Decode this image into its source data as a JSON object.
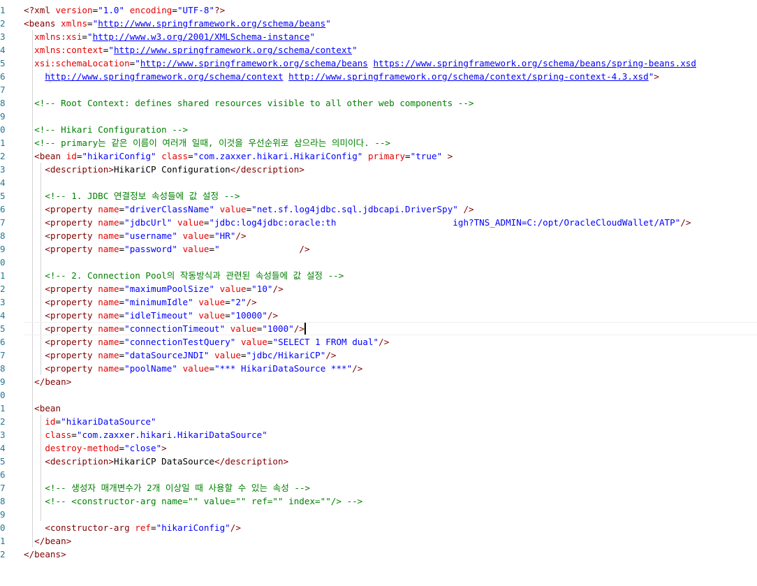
{
  "editor": {
    "line_numbers": [
      "1",
      "2",
      "3",
      "4",
      "5",
      "6",
      "7",
      "8",
      "9",
      "0",
      "1",
      "2",
      "3",
      "4",
      "5",
      "6",
      "7",
      "8",
      "9",
      "0",
      "1",
      "2",
      "3",
      "4",
      "5",
      "6",
      "7",
      "8",
      "9",
      "0",
      "1",
      "2",
      "3",
      "4",
      "5",
      "6",
      "7",
      "8",
      "9",
      "0",
      "1",
      "2"
    ],
    "lines": [
      [
        {
          "c": "t-punct",
          "t": "<?"
        },
        {
          "c": "t-tag",
          "t": "xml"
        },
        {
          "c": "t-txt",
          "t": " "
        },
        {
          "c": "t-attr",
          "t": "version"
        },
        {
          "c": "t-txt",
          "t": "="
        },
        {
          "c": "t-val",
          "t": "\"1.0\""
        },
        {
          "c": "t-txt",
          "t": " "
        },
        {
          "c": "t-attr",
          "t": "encoding"
        },
        {
          "c": "t-txt",
          "t": "="
        },
        {
          "c": "t-val",
          "t": "\"UTF-8\""
        },
        {
          "c": "t-punct",
          "t": "?>"
        }
      ],
      [
        {
          "c": "t-punct",
          "t": "<"
        },
        {
          "c": "t-tag",
          "t": "beans"
        },
        {
          "c": "t-txt",
          "t": " "
        },
        {
          "c": "t-attr",
          "t": "xmlns"
        },
        {
          "c": "t-txt",
          "t": "="
        },
        {
          "c": "t-val",
          "t": "\""
        },
        {
          "c": "t-link",
          "t": "http://www.springframework.org/schema/beans"
        },
        {
          "c": "t-val",
          "t": "\""
        }
      ],
      [
        {
          "c": "t-txt",
          "t": "  "
        },
        {
          "c": "t-attr",
          "t": "xmlns:xsi"
        },
        {
          "c": "t-txt",
          "t": "="
        },
        {
          "c": "t-val",
          "t": "\""
        },
        {
          "c": "t-link",
          "t": "http://www.w3.org/2001/XMLSchema-instance"
        },
        {
          "c": "t-val",
          "t": "\""
        }
      ],
      [
        {
          "c": "t-txt",
          "t": "  "
        },
        {
          "c": "t-attr",
          "t": "xmlns:context"
        },
        {
          "c": "t-txt",
          "t": "="
        },
        {
          "c": "t-val",
          "t": "\""
        },
        {
          "c": "t-link",
          "t": "http://www.springframework.org/schema/context"
        },
        {
          "c": "t-val",
          "t": "\""
        }
      ],
      [
        {
          "c": "t-txt",
          "t": "  "
        },
        {
          "c": "t-attr",
          "t": "xsi:schemaLocation"
        },
        {
          "c": "t-txt",
          "t": "="
        },
        {
          "c": "t-val",
          "t": "\""
        },
        {
          "c": "t-link",
          "t": "http://www.springframework.org/schema/beans"
        },
        {
          "c": "t-val",
          "t": " "
        },
        {
          "c": "t-link",
          "t": "https://www.springframework.org/schema/beans/spring-beans.xsd"
        }
      ],
      [
        {
          "c": "t-txt",
          "t": "    "
        },
        {
          "c": "t-link",
          "t": "http://www.springframework.org/schema/context"
        },
        {
          "c": "t-val",
          "t": " "
        },
        {
          "c": "t-link",
          "t": "http://www.springframework.org/schema/context/spring-context-4.3.xsd"
        },
        {
          "c": "t-val",
          "t": "\""
        },
        {
          "c": "t-punct",
          "t": ">"
        }
      ],
      [],
      [
        {
          "c": "t-txt",
          "t": "  "
        },
        {
          "c": "t-cmt",
          "t": "<!-- Root Context: defines shared resources visible to all other web components -->"
        }
      ],
      [],
      [
        {
          "c": "t-txt",
          "t": "  "
        },
        {
          "c": "t-cmt",
          "t": "<!-- Hikari Configuration -->"
        }
      ],
      [
        {
          "c": "t-txt",
          "t": "  "
        },
        {
          "c": "t-cmt",
          "t": "<!-- primary는 같은 이름이 여러개 일때, 이것을 우선순위로 삼으라는 의미이다. -->"
        }
      ],
      [
        {
          "c": "t-txt",
          "t": "  "
        },
        {
          "c": "t-punct",
          "t": "<"
        },
        {
          "c": "t-tag",
          "t": "bean"
        },
        {
          "c": "t-txt",
          "t": " "
        },
        {
          "c": "t-attr",
          "t": "id"
        },
        {
          "c": "t-txt",
          "t": "="
        },
        {
          "c": "t-val",
          "t": "\"hikariConfig\""
        },
        {
          "c": "t-txt",
          "t": " "
        },
        {
          "c": "t-attr",
          "t": "class"
        },
        {
          "c": "t-txt",
          "t": "="
        },
        {
          "c": "t-val",
          "t": "\"com.zaxxer.hikari.HikariConfig\""
        },
        {
          "c": "t-txt",
          "t": " "
        },
        {
          "c": "t-attr",
          "t": "primary"
        },
        {
          "c": "t-txt",
          "t": "="
        },
        {
          "c": "t-val",
          "t": "\"true\""
        },
        {
          "c": "t-txt",
          "t": " "
        },
        {
          "c": "t-punct",
          "t": ">"
        }
      ],
      [
        {
          "c": "t-txt",
          "t": "    "
        },
        {
          "c": "t-punct",
          "t": "<"
        },
        {
          "c": "t-tag",
          "t": "description"
        },
        {
          "c": "t-punct",
          "t": ">"
        },
        {
          "c": "t-txt",
          "t": "HikariCP Configuration"
        },
        {
          "c": "t-punct",
          "t": "</"
        },
        {
          "c": "t-tag",
          "t": "description"
        },
        {
          "c": "t-punct",
          "t": ">"
        }
      ],
      [],
      [
        {
          "c": "t-txt",
          "t": "    "
        },
        {
          "c": "t-cmt",
          "t": "<!-- 1. JDBC 연결정보 속성들에 값 설정 -->"
        }
      ],
      [
        {
          "c": "t-txt",
          "t": "    "
        },
        {
          "c": "t-punct",
          "t": "<"
        },
        {
          "c": "t-tag",
          "t": "property"
        },
        {
          "c": "t-txt",
          "t": " "
        },
        {
          "c": "t-attr",
          "t": "name"
        },
        {
          "c": "t-txt",
          "t": "="
        },
        {
          "c": "t-val",
          "t": "\"driverClassName\""
        },
        {
          "c": "t-txt",
          "t": " "
        },
        {
          "c": "t-attr",
          "t": "value"
        },
        {
          "c": "t-txt",
          "t": "="
        },
        {
          "c": "t-val",
          "t": "\"net.sf.log4jdbc.sql.jdbcapi.DriverSpy\""
        },
        {
          "c": "t-txt",
          "t": " "
        },
        {
          "c": "t-punct",
          "t": "/>"
        }
      ],
      [
        {
          "c": "t-txt",
          "t": "    "
        },
        {
          "c": "t-punct",
          "t": "<"
        },
        {
          "c": "t-tag",
          "t": "property"
        },
        {
          "c": "t-txt",
          "t": " "
        },
        {
          "c": "t-attr",
          "t": "name"
        },
        {
          "c": "t-txt",
          "t": "="
        },
        {
          "c": "t-val",
          "t": "\"jdbcUrl\""
        },
        {
          "c": "t-txt",
          "t": " "
        },
        {
          "c": "t-attr",
          "t": "value"
        },
        {
          "c": "t-txt",
          "t": "="
        },
        {
          "c": "t-val",
          "t": "\"jdbc:log4jdbc:oracle:th                      igh?TNS_ADMIN=C:/opt/OracleCloudWallet/ATP\""
        },
        {
          "c": "t-punct",
          "t": "/>"
        }
      ],
      [
        {
          "c": "t-txt",
          "t": "    "
        },
        {
          "c": "t-punct",
          "t": "<"
        },
        {
          "c": "t-tag",
          "t": "property"
        },
        {
          "c": "t-txt",
          "t": " "
        },
        {
          "c": "t-attr",
          "t": "name"
        },
        {
          "c": "t-txt",
          "t": "="
        },
        {
          "c": "t-val",
          "t": "\"username\""
        },
        {
          "c": "t-txt",
          "t": " "
        },
        {
          "c": "t-attr",
          "t": "value"
        },
        {
          "c": "t-txt",
          "t": "="
        },
        {
          "c": "t-val",
          "t": "\"HR\""
        },
        {
          "c": "t-punct",
          "t": "/>"
        }
      ],
      [
        {
          "c": "t-txt",
          "t": "    "
        },
        {
          "c": "t-punct",
          "t": "<"
        },
        {
          "c": "t-tag",
          "t": "property"
        },
        {
          "c": "t-txt",
          "t": " "
        },
        {
          "c": "t-attr",
          "t": "name"
        },
        {
          "c": "t-txt",
          "t": "="
        },
        {
          "c": "t-val",
          "t": "\"password\""
        },
        {
          "c": "t-txt",
          "t": " "
        },
        {
          "c": "t-attr",
          "t": "value"
        },
        {
          "c": "t-txt",
          "t": "="
        },
        {
          "c": "t-val",
          "t": "\"               "
        },
        {
          "c": "t-punct",
          "t": "/>"
        }
      ],
      [],
      [
        {
          "c": "t-txt",
          "t": "    "
        },
        {
          "c": "t-cmt",
          "t": "<!-- 2. Connection Pool의 작동방식과 관련된 속성들에 값 설정 -->"
        }
      ],
      [
        {
          "c": "t-txt",
          "t": "    "
        },
        {
          "c": "t-punct",
          "t": "<"
        },
        {
          "c": "t-tag",
          "t": "property"
        },
        {
          "c": "t-txt",
          "t": " "
        },
        {
          "c": "t-attr",
          "t": "name"
        },
        {
          "c": "t-txt",
          "t": "="
        },
        {
          "c": "t-val",
          "t": "\"maximumPoolSize\""
        },
        {
          "c": "t-txt",
          "t": " "
        },
        {
          "c": "t-attr",
          "t": "value"
        },
        {
          "c": "t-txt",
          "t": "="
        },
        {
          "c": "t-val",
          "t": "\"10\""
        },
        {
          "c": "t-punct",
          "t": "/>"
        }
      ],
      [
        {
          "c": "t-txt",
          "t": "    "
        },
        {
          "c": "t-punct",
          "t": "<"
        },
        {
          "c": "t-tag",
          "t": "property"
        },
        {
          "c": "t-txt",
          "t": " "
        },
        {
          "c": "t-attr",
          "t": "name"
        },
        {
          "c": "t-txt",
          "t": "="
        },
        {
          "c": "t-val",
          "t": "\"minimumIdle\""
        },
        {
          "c": "t-txt",
          "t": " "
        },
        {
          "c": "t-attr",
          "t": "value"
        },
        {
          "c": "t-txt",
          "t": "="
        },
        {
          "c": "t-val",
          "t": "\"2\""
        },
        {
          "c": "t-punct",
          "t": "/>"
        }
      ],
      [
        {
          "c": "t-txt",
          "t": "    "
        },
        {
          "c": "t-punct",
          "t": "<"
        },
        {
          "c": "t-tag",
          "t": "property"
        },
        {
          "c": "t-txt",
          "t": " "
        },
        {
          "c": "t-attr",
          "t": "name"
        },
        {
          "c": "t-txt",
          "t": "="
        },
        {
          "c": "t-val",
          "t": "\"idleTimeout\""
        },
        {
          "c": "t-txt",
          "t": " "
        },
        {
          "c": "t-attr",
          "t": "value"
        },
        {
          "c": "t-txt",
          "t": "="
        },
        {
          "c": "t-val",
          "t": "\"10000\""
        },
        {
          "c": "t-punct",
          "t": "/>"
        }
      ],
      [
        {
          "c": "t-txt",
          "t": "    "
        },
        {
          "c": "t-punct",
          "t": "<"
        },
        {
          "c": "t-tag",
          "t": "property"
        },
        {
          "c": "t-txt",
          "t": " "
        },
        {
          "c": "t-attr",
          "t": "name"
        },
        {
          "c": "t-txt",
          "t": "="
        },
        {
          "c": "t-val",
          "t": "\"connectionTimeout\""
        },
        {
          "c": "t-txt",
          "t": " "
        },
        {
          "c": "t-attr",
          "t": "value"
        },
        {
          "c": "t-txt",
          "t": "="
        },
        {
          "c": "t-val",
          "t": "\"1000\""
        },
        {
          "c": "t-punct",
          "t": "/>"
        }
      ],
      [
        {
          "c": "t-txt",
          "t": "    "
        },
        {
          "c": "t-punct",
          "t": "<"
        },
        {
          "c": "t-tag",
          "t": "property"
        },
        {
          "c": "t-txt",
          "t": " "
        },
        {
          "c": "t-attr",
          "t": "name"
        },
        {
          "c": "t-txt",
          "t": "="
        },
        {
          "c": "t-val",
          "t": "\"connectionTestQuery\""
        },
        {
          "c": "t-txt",
          "t": " "
        },
        {
          "c": "t-attr",
          "t": "value"
        },
        {
          "c": "t-txt",
          "t": "="
        },
        {
          "c": "t-val",
          "t": "\"SELECT 1 FROM dual\""
        },
        {
          "c": "t-punct",
          "t": "/>"
        }
      ],
      [
        {
          "c": "t-txt",
          "t": "    "
        },
        {
          "c": "t-punct",
          "t": "<"
        },
        {
          "c": "t-tag",
          "t": "property"
        },
        {
          "c": "t-txt",
          "t": " "
        },
        {
          "c": "t-attr",
          "t": "name"
        },
        {
          "c": "t-txt",
          "t": "="
        },
        {
          "c": "t-val",
          "t": "\"dataSourceJNDI\""
        },
        {
          "c": "t-txt",
          "t": " "
        },
        {
          "c": "t-attr",
          "t": "value"
        },
        {
          "c": "t-txt",
          "t": "="
        },
        {
          "c": "t-val",
          "t": "\"jdbc/HikariCP\""
        },
        {
          "c": "t-punct",
          "t": "/>"
        }
      ],
      [
        {
          "c": "t-txt",
          "t": "    "
        },
        {
          "c": "t-punct",
          "t": "<"
        },
        {
          "c": "t-tag",
          "t": "property"
        },
        {
          "c": "t-txt",
          "t": " "
        },
        {
          "c": "t-attr",
          "t": "name"
        },
        {
          "c": "t-txt",
          "t": "="
        },
        {
          "c": "t-val",
          "t": "\"poolName\""
        },
        {
          "c": "t-txt",
          "t": " "
        },
        {
          "c": "t-attr",
          "t": "value"
        },
        {
          "c": "t-txt",
          "t": "="
        },
        {
          "c": "t-val",
          "t": "\"*** HikariDataSource ***\""
        },
        {
          "c": "t-punct",
          "t": "/>"
        }
      ],
      [
        {
          "c": "t-txt",
          "t": "  "
        },
        {
          "c": "t-punct",
          "t": "</"
        },
        {
          "c": "t-tag",
          "t": "bean"
        },
        {
          "c": "t-punct",
          "t": ">"
        }
      ],
      [],
      [
        {
          "c": "t-txt",
          "t": "  "
        },
        {
          "c": "t-punct",
          "t": "<"
        },
        {
          "c": "t-tag",
          "t": "bean"
        }
      ],
      [
        {
          "c": "t-txt",
          "t": "    "
        },
        {
          "c": "t-attr",
          "t": "id"
        },
        {
          "c": "t-txt",
          "t": "="
        },
        {
          "c": "t-val",
          "t": "\"hikariDataSource\""
        }
      ],
      [
        {
          "c": "t-txt",
          "t": "    "
        },
        {
          "c": "t-attr",
          "t": "class"
        },
        {
          "c": "t-txt",
          "t": "="
        },
        {
          "c": "t-val",
          "t": "\"com.zaxxer.hikari.HikariDataSource\""
        }
      ],
      [
        {
          "c": "t-txt",
          "t": "    "
        },
        {
          "c": "t-attr",
          "t": "destroy-method"
        },
        {
          "c": "t-txt",
          "t": "="
        },
        {
          "c": "t-val",
          "t": "\"close\""
        },
        {
          "c": "t-punct",
          "t": ">"
        }
      ],
      [
        {
          "c": "t-txt",
          "t": "    "
        },
        {
          "c": "t-punct",
          "t": "<"
        },
        {
          "c": "t-tag",
          "t": "description"
        },
        {
          "c": "t-punct",
          "t": ">"
        },
        {
          "c": "t-txt",
          "t": "HikariCP DataSource"
        },
        {
          "c": "t-punct",
          "t": "</"
        },
        {
          "c": "t-tag",
          "t": "description"
        },
        {
          "c": "t-punct",
          "t": ">"
        }
      ],
      [],
      [
        {
          "c": "t-txt",
          "t": "    "
        },
        {
          "c": "t-cmt",
          "t": "<!-- 생성자 매개변수가 2개 이상일 때 사용할 수 있는 속성 -->"
        }
      ],
      [
        {
          "c": "t-txt",
          "t": "    "
        },
        {
          "c": "t-cmt",
          "t": "<!-- <constructor-arg name=\"\" value=\"\" ref=\"\" index=\"\"/> -->"
        }
      ],
      [],
      [
        {
          "c": "t-txt",
          "t": "    "
        },
        {
          "c": "t-punct",
          "t": "<"
        },
        {
          "c": "t-tag",
          "t": "constructor-arg"
        },
        {
          "c": "t-txt",
          "t": " "
        },
        {
          "c": "t-attr",
          "t": "ref"
        },
        {
          "c": "t-txt",
          "t": "="
        },
        {
          "c": "t-val",
          "t": "\"hikariConfig\""
        },
        {
          "c": "t-punct",
          "t": "/>"
        }
      ],
      [
        {
          "c": "t-txt",
          "t": "  "
        },
        {
          "c": "t-punct",
          "t": "</"
        },
        {
          "c": "t-tag",
          "t": "bean"
        },
        {
          "c": "t-punct",
          "t": ">"
        }
      ],
      [
        {
          "c": "t-punct",
          "t": "</"
        },
        {
          "c": "t-tag",
          "t": "beans"
        },
        {
          "c": "t-punct",
          "t": ">"
        }
      ]
    ],
    "current_line_index": 24
  }
}
